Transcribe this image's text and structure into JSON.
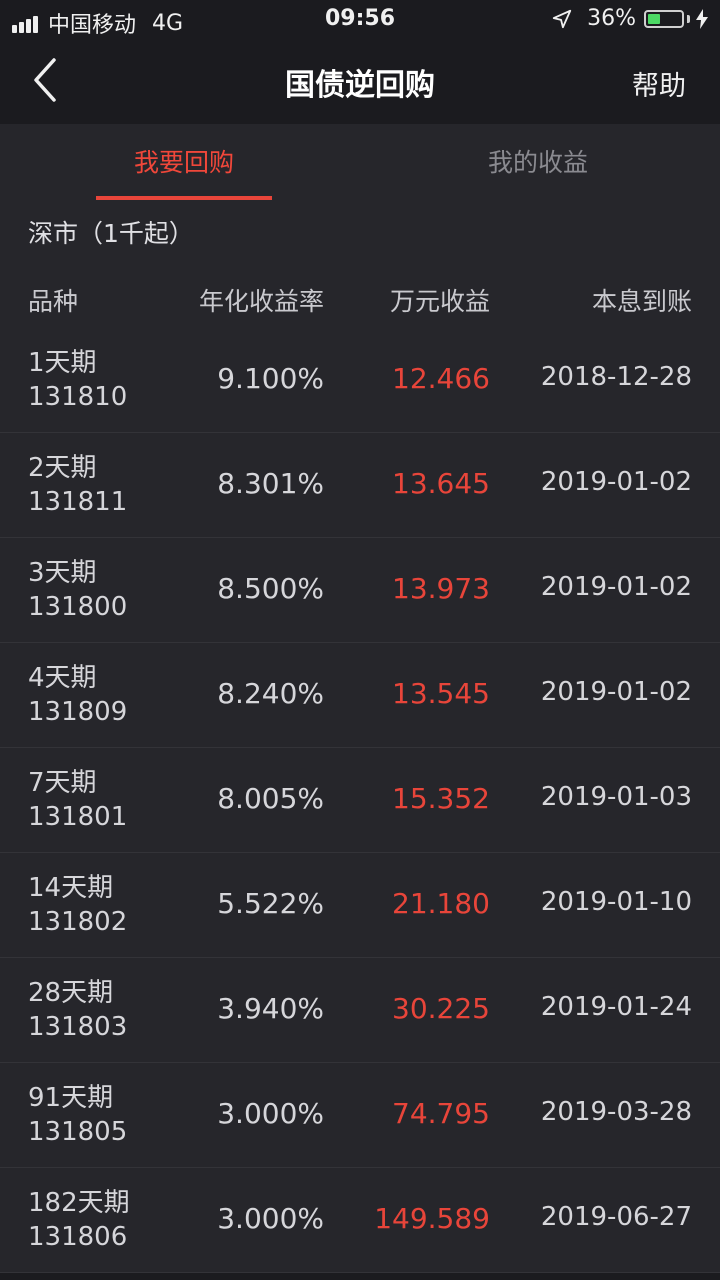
{
  "status_bar": {
    "carrier": "中国移动",
    "network": "4G",
    "time": "09:56",
    "battery_percent": "36%",
    "battery_level": 0.36
  },
  "nav": {
    "title": "国债逆回购",
    "help_label": "帮助",
    "back_icon": "chevron-left-icon"
  },
  "tabs": [
    {
      "label": "我要回购",
      "active": true
    },
    {
      "label": "我的收益",
      "active": false
    }
  ],
  "section": {
    "title": "深市（1千起）"
  },
  "table": {
    "headers": [
      "品种",
      "年化收益率",
      "万元收益",
      "本息到账"
    ],
    "rows": [
      {
        "name": "1天期",
        "code": "131810",
        "rate": "9.100%",
        "profit": "12.466",
        "date": "2018-12-28"
      },
      {
        "name": "2天期",
        "code": "131811",
        "rate": "8.301%",
        "profit": "13.645",
        "date": "2019-01-02"
      },
      {
        "name": "3天期",
        "code": "131800",
        "rate": "8.500%",
        "profit": "13.973",
        "date": "2019-01-02"
      },
      {
        "name": "4天期",
        "code": "131809",
        "rate": "8.240%",
        "profit": "13.545",
        "date": "2019-01-02"
      },
      {
        "name": "7天期",
        "code": "131801",
        "rate": "8.005%",
        "profit": "15.352",
        "date": "2019-01-03"
      },
      {
        "name": "14天期",
        "code": "131802",
        "rate": "5.522%",
        "profit": "21.180",
        "date": "2019-01-10"
      },
      {
        "name": "28天期",
        "code": "131803",
        "rate": "3.940%",
        "profit": "30.225",
        "date": "2019-01-24"
      },
      {
        "name": "91天期",
        "code": "131805",
        "rate": "3.000%",
        "profit": "74.795",
        "date": "2019-03-28"
      },
      {
        "name": "182天期",
        "code": "131806",
        "rate": "3.000%",
        "profit": "149.589",
        "date": "2019-06-27"
      }
    ]
  },
  "colors": {
    "accent": "#e8453a",
    "background": "#1b1b1f",
    "panel": "#26262b",
    "battery": "#4cd964"
  }
}
